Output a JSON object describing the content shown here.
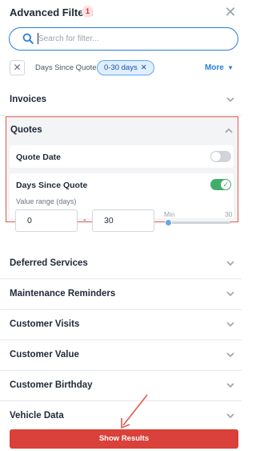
{
  "header": {
    "title": "Advanced Filters",
    "badge_count": "1",
    "close_icon": "close-icon"
  },
  "search": {
    "placeholder": "Search for filter...",
    "value": "",
    "icon": "search-icon"
  },
  "active_filters": {
    "clear_icon": "close-icon",
    "label": "Days Since Quote:",
    "chip_value": "0-30 days",
    "more_label": "More"
  },
  "sections": {
    "invoices": "Invoices",
    "quotes": "Quotes",
    "deferred": "Deferred Services",
    "maintenance": "Maintenance Reminders",
    "visits": "Customer Visits",
    "value": "Customer Value",
    "birthday": "Customer Birthday",
    "vehicle": "Vehicle Data"
  },
  "quotes": {
    "quote_date": {
      "label": "Quote Date",
      "enabled": false
    },
    "days_since": {
      "label": "Days Since Quote",
      "enabled": true,
      "range_label": "Value range (days)",
      "min_value": "0",
      "max_value": "30",
      "slider_min_label": "Min",
      "slider_max_label": "30",
      "slider_min_fraction": 0,
      "slider_max_fraction": 1
    }
  },
  "footer": {
    "show_results_label": "Show Results"
  },
  "colors": {
    "accent_blue": "#2b7fd9",
    "chip_bg": "#e0efff",
    "highlight_red": "#e05a4e",
    "button_red": "#d9413a",
    "toggle_green": "#3fae6a"
  }
}
